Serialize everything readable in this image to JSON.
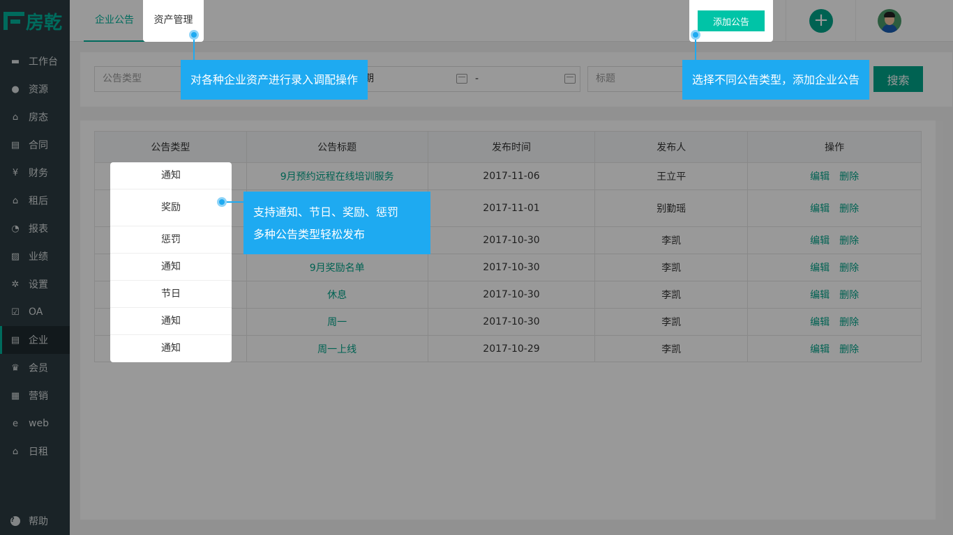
{
  "brand": {
    "logo_text": "房乾"
  },
  "sidebar": {
    "items": [
      {
        "label": "工作台",
        "icon": "monitor-icon"
      },
      {
        "label": "资源",
        "icon": "bag-icon"
      },
      {
        "label": "房态",
        "icon": "home-icon"
      },
      {
        "label": "合同",
        "icon": "document-icon"
      },
      {
        "label": "财务",
        "icon": "yen-icon"
      },
      {
        "label": "租后",
        "icon": "home-icon"
      },
      {
        "label": "报表",
        "icon": "pie-chart-icon"
      },
      {
        "label": "业绩",
        "icon": "trend-chart-icon"
      },
      {
        "label": "设置",
        "icon": "gear-icon"
      },
      {
        "label": "OA",
        "icon": "checkbox-icon"
      },
      {
        "label": "企业",
        "icon": "document-icon"
      },
      {
        "label": "会员",
        "icon": "crown-icon"
      },
      {
        "label": "营销",
        "icon": "gift-icon"
      },
      {
        "label": "web",
        "icon": "e-icon"
      },
      {
        "label": "日租",
        "icon": "home-icon"
      }
    ],
    "active_index": 10,
    "help_label": "帮助"
  },
  "header": {
    "tabs": [
      {
        "label": "企业公告"
      },
      {
        "label": "资产管理"
      }
    ],
    "add_button": "添加公告"
  },
  "filter": {
    "type_placeholder": "公告类型",
    "date_partial": "期",
    "date_separator": "-",
    "title_placeholder": "标题",
    "search_button": "搜索"
  },
  "table": {
    "headers": [
      "公告类型",
      "公告标题",
      "发布时间",
      "发布人",
      "操作"
    ],
    "rows": [
      {
        "type": "通知",
        "title": "9月预约远程在线培训服务",
        "date": "2017-11-06",
        "author": "王立平"
      },
      {
        "type": "奖励",
        "title": "",
        "date": "2017-11-01",
        "author": "别勤瑶"
      },
      {
        "type": "惩罚",
        "title": "",
        "date": "2017-10-30",
        "author": "李凯"
      },
      {
        "type": "通知",
        "title": "9月奖励名单",
        "date": "2017-10-30",
        "author": "李凯"
      },
      {
        "type": "节日",
        "title": "休息",
        "date": "2017-10-30",
        "author": "李凯"
      },
      {
        "type": "通知",
        "title": "周一",
        "date": "2017-10-30",
        "author": "李凯"
      },
      {
        "type": "通知",
        "title": "周一上线",
        "date": "2017-10-29",
        "author": "李凯"
      }
    ],
    "op_edit": "编辑",
    "op_delete": "删除"
  },
  "tooltips": {
    "asset": "对各种企业资产进行录入调配操作",
    "add": "选择不同公告类型，添加企业公告",
    "types_line1": "支持通知、节日、奖励、惩罚",
    "types_line2": "多种公告类型轻松发布"
  },
  "colors": {
    "accent": "#00a389",
    "sidebar_bg": "#2c3b41",
    "tooltip": "#1eaaf1"
  }
}
